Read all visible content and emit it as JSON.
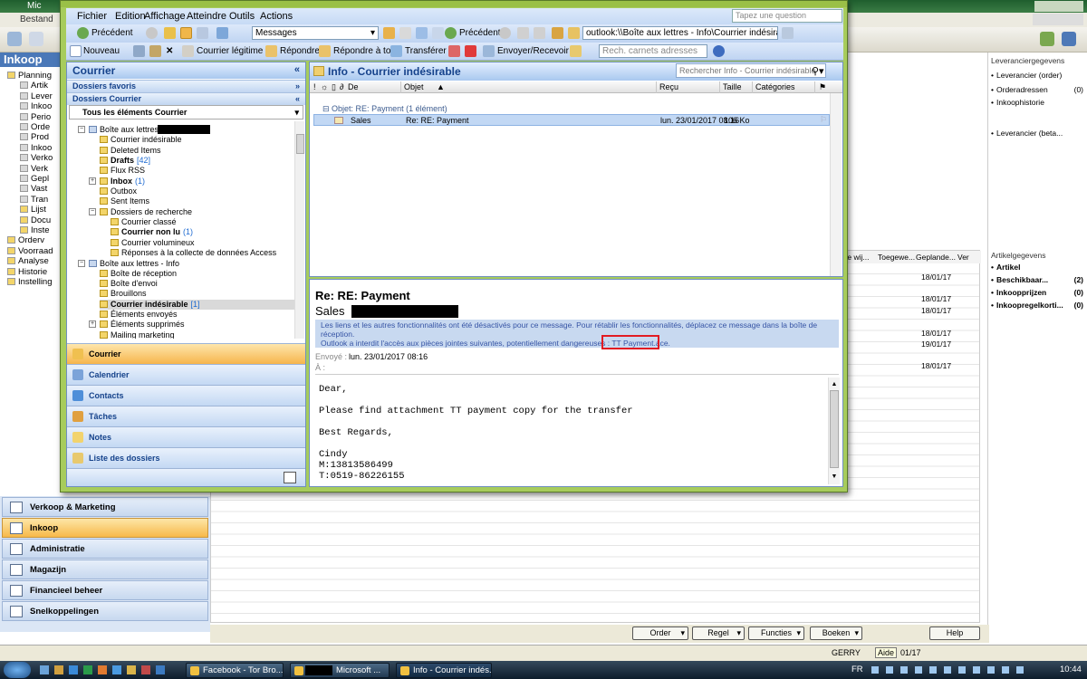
{
  "background_app": {
    "title": "Mic",
    "menu_first": "Bestand",
    "section_title": "Inkoop",
    "tree_items": [
      "Planning",
      "Artik",
      "Lever",
      "Inkoo",
      "Perio",
      "Orde",
      "Prod",
      "Inkoo",
      "Verko",
      "Verk",
      "Gepl",
      "Vast",
      "Tran",
      "Lijst",
      "Docu",
      "Inste",
      "Orderv",
      "Voorraad",
      "Analyse",
      "Historie",
      "Instelling"
    ],
    "grid_columns": [
      "te wij...",
      "Toegewe...",
      "Geplande...",
      "Ver"
    ],
    "grid_dates": [
      "18/01/17",
      "18/01/17",
      "18/01/17",
      "18/01/17",
      "19/01/17",
      "18/01/17"
    ],
    "right_panel": {
      "title": "Leveranciergegevens",
      "items": [
        {
          "label": "Leverancier (order)",
          "value": ""
        },
        {
          "label": "Orderadressen",
          "value": "(0)"
        },
        {
          "label": "Inkoophistorie",
          "value": ""
        },
        {
          "label": "Leverancier (beta...",
          "value": ""
        }
      ],
      "title2": "Artikelgegevens",
      "items2": [
        {
          "label": "Artikel",
          "value": ""
        },
        {
          "label": "Beschikbaar...",
          "value": "(2)"
        },
        {
          "label": "Inkoopprijzen",
          "value": "(0)"
        },
        {
          "label": "Inkoopregelkorti...",
          "value": "(0)"
        }
      ]
    },
    "nav_buttons": [
      "Verkoop & Marketing",
      "Inkoop",
      "Administratie",
      "Magazijn",
      "Financieel beheer",
      "Snelkoppelingen"
    ],
    "bottom_buttons": [
      "Order",
      "Regel",
      "Functies",
      "Boeken",
      "Help"
    ],
    "status_user": "GERRY",
    "status_aide": "Aide",
    "status_date": "01/17"
  },
  "taskbar": {
    "tasks": [
      "Facebook - Tor Bro...",
      "Microsoft ...",
      "Info - Courrier indés..."
    ],
    "lang": "FR",
    "clock": "10:44"
  },
  "outlook": {
    "menus": [
      "Fichier",
      "Edition",
      "Affichage",
      "Atteindre",
      "Outils",
      "Actions"
    ],
    "question_placeholder": "Tapez une question",
    "toolbar1": {
      "back": "Précédent",
      "view_select": "Messages",
      "back2": "Précédent",
      "address": "outlook:\\\\Boîte aux lettres - Info\\Courrier indésirable"
    },
    "toolbar2": {
      "new": "Nouveau",
      "legit": "Courrier légitime",
      "reply": "Répondre",
      "reply_all": "Répondre à tous",
      "forward": "Transférer",
      "send_receive": "Envoyer/Recevoir",
      "address_book_placeholder": "Rech. carnets adresses"
    },
    "nav": {
      "header": "Courrier",
      "favorites": "Dossiers favoris",
      "folders": "Dossiers Courrier",
      "all_items": "Tous les éléments Courrier",
      "tree": [
        {
          "label": "Boîte aux lettres -",
          "count": "",
          "bold": false,
          "indent": 0
        },
        {
          "label": "Courrier indésirable",
          "count": "",
          "bold": false,
          "indent": 1
        },
        {
          "label": "Deleted Items",
          "count": "",
          "bold": false,
          "indent": 1
        },
        {
          "label": "Drafts",
          "count": "[42]",
          "bold": true,
          "indent": 1
        },
        {
          "label": "Flux RSS",
          "count": "",
          "bold": false,
          "indent": 1
        },
        {
          "label": "Inbox",
          "count": "(1)",
          "bold": true,
          "indent": 1
        },
        {
          "label": "Outbox",
          "count": "",
          "bold": false,
          "indent": 1
        },
        {
          "label": "Sent Items",
          "count": "",
          "bold": false,
          "indent": 1
        },
        {
          "label": "Dossiers de recherche",
          "count": "",
          "bold": false,
          "indent": 1
        },
        {
          "label": "Courrier classé",
          "count": "",
          "bold": false,
          "indent": 2
        },
        {
          "label": "Courrier non lu",
          "count": "(1)",
          "bold": true,
          "indent": 2
        },
        {
          "label": "Courrier volumineux",
          "count": "",
          "bold": false,
          "indent": 2
        },
        {
          "label": "Réponses à la collecte de données Access",
          "count": "",
          "bold": false,
          "indent": 2
        },
        {
          "label": "Boîte aux lettres - Info",
          "count": "",
          "bold": false,
          "indent": 0
        },
        {
          "label": "Boîte de réception",
          "count": "",
          "bold": false,
          "indent": 1
        },
        {
          "label": "Boîte d'envoi",
          "count": "",
          "bold": false,
          "indent": 1
        },
        {
          "label": "Brouillons",
          "count": "",
          "bold": false,
          "indent": 1
        },
        {
          "label": "Courrier indésirable",
          "count": "[1]",
          "bold": true,
          "indent": 1
        },
        {
          "label": "Éléments envoyés",
          "count": "",
          "bold": false,
          "indent": 1
        },
        {
          "label": "Éléments supprimés",
          "count": "",
          "bold": false,
          "indent": 1
        },
        {
          "label": "Mailing marketing",
          "count": "",
          "bold": false,
          "indent": 1
        }
      ],
      "buttons": [
        "Courrier",
        "Calendrier",
        "Contacts",
        "Tâches",
        "Notes",
        "Liste des dossiers"
      ]
    },
    "list": {
      "title": "Info - Courrier indésirable",
      "search_placeholder": "Rechercher Info - Courrier indésirable",
      "columns": [
        "De",
        "Objet",
        "Reçu",
        "Taille",
        "Catégories"
      ],
      "group": "Objet: RE: Payment (1 élément)",
      "rows": [
        {
          "from": "Sales",
          "subject": "Re: RE: Payment",
          "received": "lun. 23/01/2017 08:16",
          "size": "106 Ko"
        }
      ]
    },
    "reading": {
      "subject": "Re: RE: Payment",
      "from": "Sales",
      "info_line1": "Les liens et les autres fonctionnalités ont été désactivés pour ce message. Pour rétablir les fonctionnalités, déplacez ce message dans la boîte de",
      "info_line2": "réception.",
      "info_line3": "Outlook a interdit l'accès aux pièces jointes suivantes, potentiellement dangereuses :",
      "attachment": "TT  Payment.ace.",
      "sent_label": "Envoyé :",
      "sent_value": "lun. 23/01/2017 08:16",
      "to_label": "À :",
      "body": "Dear,\n\nPlease find attachment TT payment copy for the transfer\n\nBest Regards,\n\nCindy\nM:13813586499\nT:0519-86226155"
    }
  }
}
